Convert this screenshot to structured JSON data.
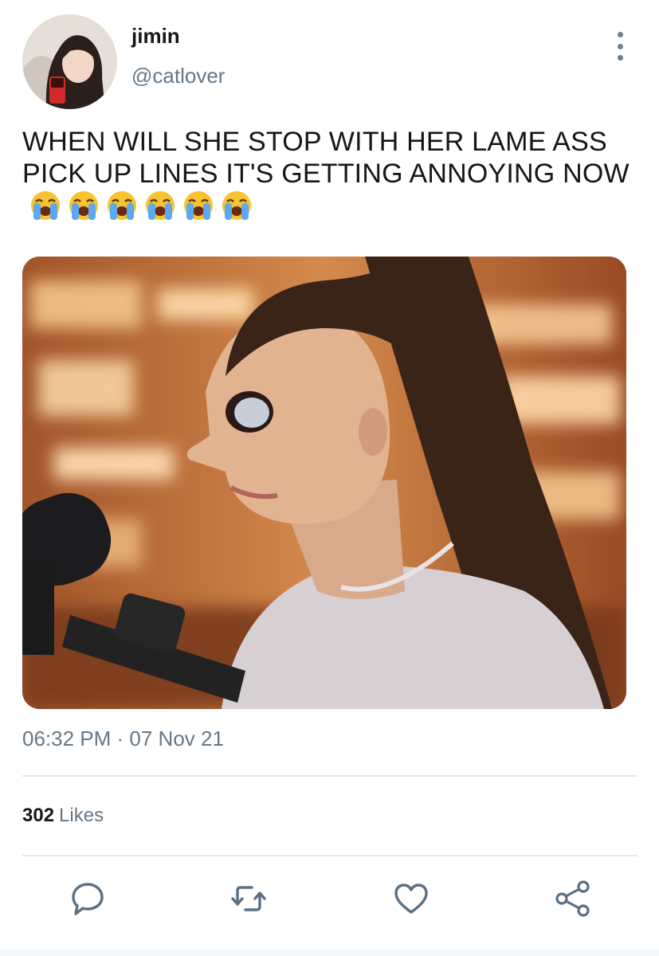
{
  "user": {
    "display_name": "jimin",
    "handle": "@catlover"
  },
  "tweet": {
    "text": "WHEN WILL SHE STOP WITH HER LAME ASS PICK UP LINES IT'S GETTING ANNOYING NOW",
    "emoji": "loudly-crying-face",
    "emoji_count": 6,
    "timestamp": "06:32 PM · 07 Nov 21"
  },
  "stats": {
    "likes_count": "302",
    "likes_label": "Likes"
  },
  "actions": {
    "icons": [
      "reply-icon",
      "retweet-icon",
      "like-icon",
      "share-icon"
    ]
  },
  "colors": {
    "secondary_text": "#657786",
    "divider": "#e1e8ed",
    "icon": "#5b7083"
  }
}
